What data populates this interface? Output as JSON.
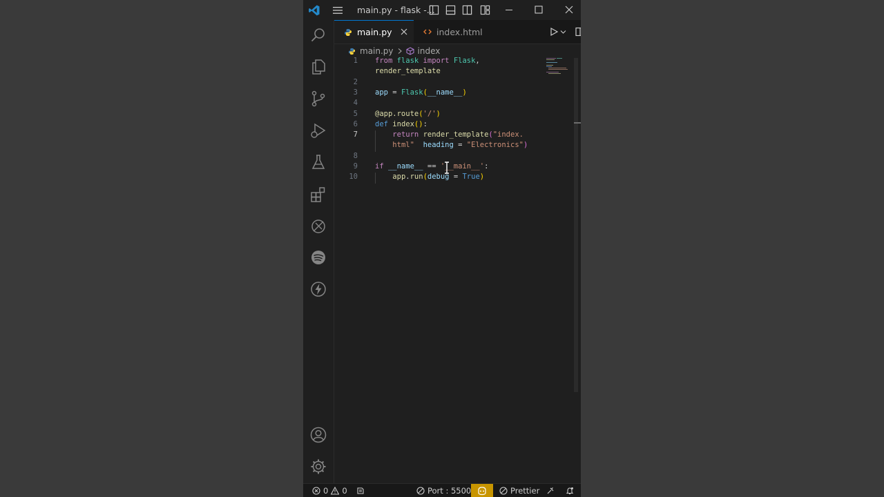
{
  "titlebar": {
    "title": "main.py - flask -..."
  },
  "tabs": [
    {
      "label": "main.py",
      "active": true
    },
    {
      "label": "index.html",
      "active": false
    }
  ],
  "breadcrumb": {
    "file": "main.py",
    "symbol": "index"
  },
  "code": {
    "line_numbers": [
      "1",
      "",
      "2",
      "3",
      "4",
      "5",
      "6",
      "7",
      "",
      "8",
      "9",
      "10"
    ],
    "lines": [
      {
        "n": "1",
        "segs": [
          [
            "kw",
            "from "
          ],
          [
            "cls",
            "flask "
          ],
          [
            "kw",
            "import "
          ],
          [
            "cls",
            "Flask"
          ],
          [
            "op",
            ","
          ]
        ]
      },
      {
        "n": "",
        "segs": [
          [
            "fn",
            "render_template"
          ]
        ]
      },
      {
        "n": "2",
        "segs": []
      },
      {
        "n": "3",
        "segs": [
          [
            "var",
            "app "
          ],
          [
            "op",
            "= "
          ],
          [
            "cls",
            "Flask"
          ],
          [
            "paren",
            "("
          ],
          [
            "var",
            "__name__"
          ],
          [
            "paren",
            ")"
          ]
        ]
      },
      {
        "n": "4",
        "segs": []
      },
      {
        "n": "5",
        "segs": [
          [
            "deco",
            "@app.route"
          ],
          [
            "paren",
            "("
          ],
          [
            "str",
            "'/'"
          ],
          [
            "paren",
            ")"
          ]
        ]
      },
      {
        "n": "6",
        "segs": [
          [
            "kw2",
            "def "
          ],
          [
            "fn",
            "index"
          ],
          [
            "paren",
            "()"
          ],
          [
            "op",
            ":"
          ]
        ]
      },
      {
        "n": "7",
        "segs": [
          [
            "op",
            "    "
          ],
          [
            "kw",
            "return "
          ],
          [
            "fn",
            "render_template"
          ],
          [
            "paren2",
            "("
          ],
          [
            "str",
            "\"index."
          ]
        ]
      },
      {
        "n": "",
        "segs": [
          [
            "op",
            "    "
          ],
          [
            "str",
            "html\""
          ],
          [
            "op",
            "  "
          ],
          [
            "var",
            "heading "
          ],
          [
            "op",
            "= "
          ],
          [
            "str",
            "\"Electronics\""
          ],
          [
            "paren2",
            ")"
          ]
        ]
      },
      {
        "n": "8",
        "segs": []
      },
      {
        "n": "9",
        "segs": [
          [
            "kw",
            "if "
          ],
          [
            "var",
            "__name__ "
          ],
          [
            "op",
            "== "
          ],
          [
            "str",
            "'__main__'"
          ],
          [
            "op",
            ":"
          ]
        ]
      },
      {
        "n": "10",
        "segs": [
          [
            "op",
            "    "
          ],
          [
            "fn",
            "app"
          ],
          [
            "op",
            "."
          ],
          [
            "fn",
            "run"
          ],
          [
            "paren",
            "("
          ],
          [
            "var",
            "debug "
          ],
          [
            "op",
            "= "
          ],
          [
            "kw2",
            "True"
          ],
          [
            "paren",
            ")"
          ]
        ]
      }
    ]
  },
  "statusbar": {
    "errors": "0",
    "warnings": "0",
    "port": "Port : 5500",
    "prettier": "Prettier"
  },
  "colors": {
    "accent": "#0078d4",
    "status_highlight": "#c89500",
    "keyword": "#c586c0",
    "string": "#ce9178",
    "function": "#dcdcaa",
    "class": "#4ec9b0",
    "variable": "#9cdcfe"
  }
}
